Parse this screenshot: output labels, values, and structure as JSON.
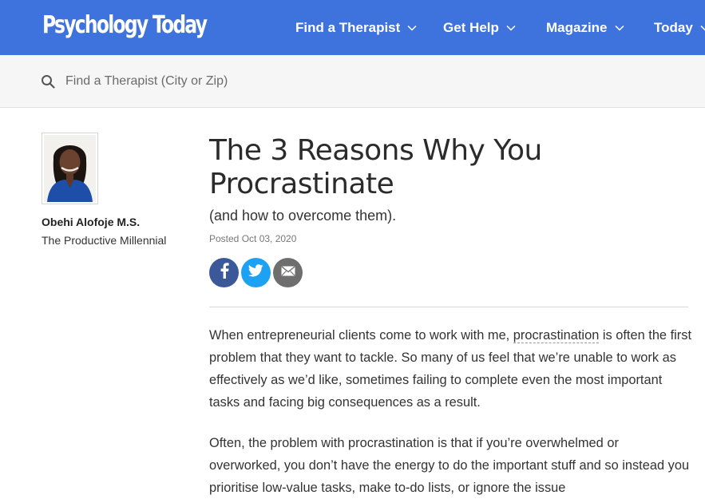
{
  "header": {
    "logo_text": "Psychology Today",
    "nav": [
      {
        "label": "Find a Therapist"
      },
      {
        "label": "Get Help"
      },
      {
        "label": "Magazine"
      },
      {
        "label": "Today"
      }
    ],
    "brand_color": "#3e73dd"
  },
  "search": {
    "placeholder": "Find a Therapist (City or Zip)",
    "value": ""
  },
  "author": {
    "name": "Obehi Alofoje M.S.",
    "blog": "The Productive Millennial"
  },
  "article": {
    "title": "The 3 Reasons Why You Procrastinate",
    "subtitle": "(and how to overcome them).",
    "posted": "Posted Oct 03, 2020",
    "share": [
      {
        "icon": "facebook-icon",
        "color": "#3b5998"
      },
      {
        "icon": "twitter-icon",
        "color": "#1da1f2"
      },
      {
        "icon": "email-icon",
        "color": "#6e6e6e"
      }
    ],
    "para1_before": "When entrepreneurial clients come to work with me, ",
    "para1_link": "procrastination",
    "para1_after": " is often the first problem that they want to tackle. So many of us feel that we’re unable to work as effectively as we’d like, sometimes failing to complete even the most important tasks and facing big consequences as a result.",
    "para2": "Often, the problem with procrastination is that if you’re overwhelmed or overworked, you don’t have the energy to do the important stuff and so instead you prioritise low-value tasks, make to-do lists, or ignore the issue"
  }
}
